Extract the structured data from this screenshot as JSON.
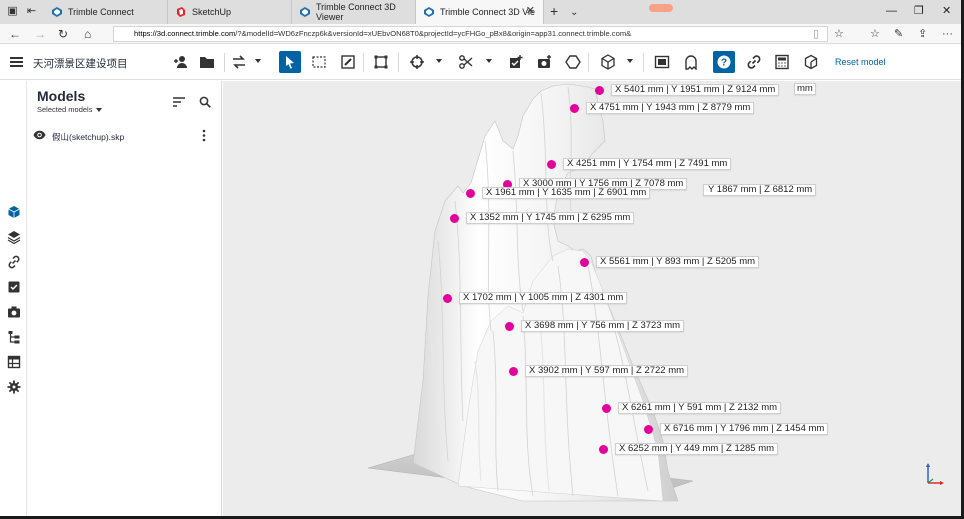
{
  "browser": {
    "tabs": [
      {
        "title": "Trimble Connect",
        "icon": "trimble-icon"
      },
      {
        "title": "SketchUp",
        "icon": "sketchup-icon"
      },
      {
        "title": "Trimble Connect 3D Viewer",
        "icon": "trimble-icon"
      },
      {
        "title": "Trimble Connect 3D Vie",
        "icon": "trimble-icon",
        "active": true
      }
    ],
    "url_host": "https://3d.connect.trimble.com",
    "url_rest": "/?&modelId=WD6zFnczp6k&versionId=xUEbvON68T0&projectId=ycFHGo_pBx8&origin=app31.connect.trimble.com&"
  },
  "toolbar": {
    "project_title": "天河漂景区建设项目",
    "reset_label": "Reset model"
  },
  "models_panel": {
    "title": "Models",
    "subtitle": "Selected models",
    "model_name": "假山(sketchup).skp"
  },
  "measure_points": [
    {
      "label": "X 5401 mm | Y 1951 mm | Z 9124 mm"
    },
    {
      "label": "X 4751 mm | Y 1943 mm | Z 8779 mm"
    },
    {
      "label": "X 4251 mm | Y 1754 mm | Z 7491 mm"
    },
    {
      "label": "X 3000 mm | Y 1756 mm | Z 7078 mm"
    },
    {
      "label": "X 1961 mm | Y 1635 mm | Z 6901 mm"
    },
    {
      "label": "X 1352 mm | Y 1745 mm | Z 6295 mm"
    },
    {
      "label": "X 5561 mm | Y 893 mm | Z 5205 mm"
    },
    {
      "label": "X 1702 mm | Y 1005 mm | Z 4301 mm"
    },
    {
      "label": "X 3698 mm | Y 756 mm | Z 3723 mm"
    },
    {
      "label": "X 3902 mm | Y 597 mm | Z 2722 mm"
    },
    {
      "label": "X 6261 mm | Y 591 mm | Z 2132 mm"
    },
    {
      "label": "X 6716 mm | Y 1796 mm | Z 1454 mm"
    },
    {
      "label": "X 6252 mm | Y 449 mm | Z 1285 mm"
    },
    {
      "label": "mm"
    },
    {
      "label": "Y 1867 mm | Z 6812 mm"
    }
  ],
  "colors": {
    "accent": "#0063a3",
    "marker": "#e4009a",
    "viewport_bg": "#ececec"
  }
}
